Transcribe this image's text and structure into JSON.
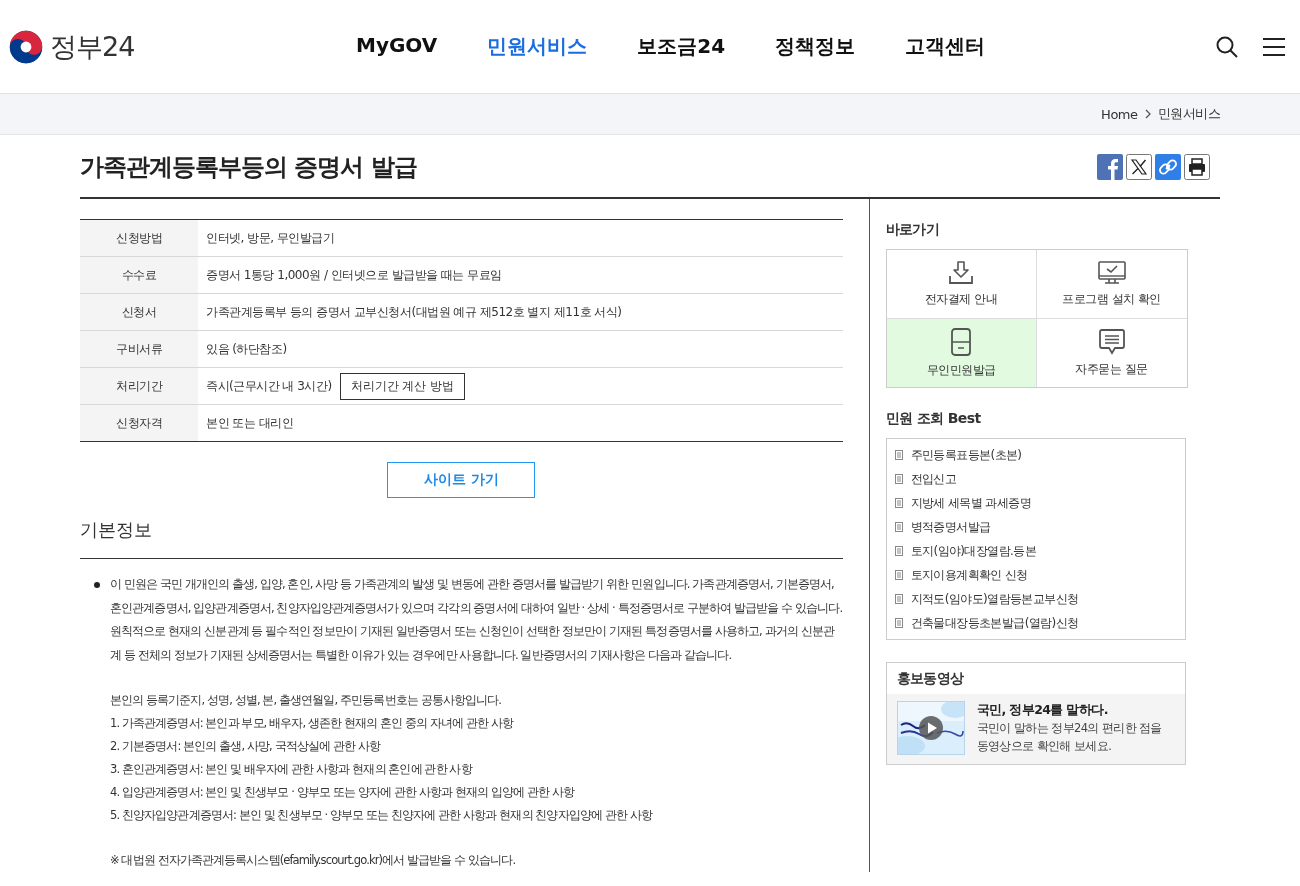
{
  "header": {
    "logo": "정부24",
    "nav": [
      {
        "label": "MyGOV",
        "selected": false
      },
      {
        "label": "민원서비스",
        "selected": true
      },
      {
        "label": "보조금24",
        "selected": false
      },
      {
        "label": "정책정보",
        "selected": false
      },
      {
        "label": "고객센터",
        "selected": false
      }
    ]
  },
  "breadcrumb": [
    "Home",
    "민원서비스"
  ],
  "page_title": "가족관계등록부등의 증명서 발급",
  "summary_table": {
    "rows": [
      {
        "label": "신청방법",
        "value": "인터넷, 방문, 무인발급기"
      },
      {
        "label": "수수료",
        "value": "증명서 1통당 1,000원 / 인터넷으로 발급받을 때는 무료임"
      },
      {
        "label": "신청서",
        "value": "가족관계등록부 등의 증명서 교부신청서(대법원 예규 제512호 별지 제11호 서식)"
      },
      {
        "label": "구비서류",
        "value": "있음 (하단참조)"
      },
      {
        "label": "처리기간",
        "value": "즉시(근무시간 내 3시간)",
        "button": "처리기간 계산 방법"
      },
      {
        "label": "신청자격",
        "value": "본인 또는 대리인"
      }
    ]
  },
  "site_button": "사이트 가기",
  "section_title": "기본정보",
  "description": {
    "intro": "이 민원은 국민 개개인의 출생, 입양, 혼인, 사망 등 가족관계의 발생 및 변동에 관한 증명서를 발급받기 위한 민원입니다. 가족관계증명서, 기본증명서, 혼인관계증명서, 입양관계증명서, 친양자입양관계증명서가 있으며 각각의 증명서에 대하여 일반 · 상세 · 특정증명서로 구분하여 발급받을 수 있습니다. 원칙적으로 현재의 신분관계 등 필수적인 정보만이 기재된 일반증명서 또는 신청인이 선택한 정보만이 기재된 특정증명서를 사용하고, 과거의 신분관계 등 전체의 정보가 기재된 상세증명서는 특별한 이유가 있는 경우에만 사용합니다. 일반증명서의 기재사항은 다음과 같습니다.",
    "common": "본인의 등록기준지, 성명, 성별, 본, 출생연월일, 주민등록번호는 공통사항입니다.",
    "items": [
      "1. 가족관계증명서: 본인과 부모, 배우자, 생존한 현재의 혼인 중의 자녀에 관한 사항",
      "2. 기본증명서: 본인의 출생, 사망, 국적상실에 관한 사항",
      "3. 혼인관계증명서: 본인 및 배우자에 관한 사항과 현재의 혼인에 관한 사항",
      "4. 입양관계증명서: 본인 및 친생부모 · 양부모 또는 양자에 관한 사항과 현재의 입양에 관한 사항",
      "5. 친양자입양관계증명서: 본인 및 친생부모 · 양부모 또는 친양자에 관한 사항과 현재의 친양자입양에 관한 사항"
    ],
    "note": "※ 대법원 전자가족관계등록시스템(efamily.scourt.go.kr)에서 발급받을 수 있습니다."
  },
  "sidebar": {
    "quick_title": "바로가기",
    "quick_links": [
      {
        "label": "전자결제 안내",
        "kind": "download",
        "selected": false
      },
      {
        "label": "프로그램 설치 확인",
        "kind": "monitor",
        "selected": false
      },
      {
        "label": "무인민원발급",
        "kind": "kiosk",
        "selected": true
      },
      {
        "label": "자주묻는 질문",
        "kind": "chat",
        "selected": false
      }
    ],
    "best_title": "민원 조회 Best",
    "best_items": [
      "주민등록표등본(초본)",
      "전입신고",
      "지방세 세목별 과세증명",
      "병적증명서발급",
      "토지(임야)대장열람.등본",
      "토지이용계획확인 신청",
      "지적도(임야도)열람등본교부신청",
      "건축물대장등초본발급(열람)신청"
    ],
    "video": {
      "title": "홍보동영상",
      "headline": "국민, 정부24를 말하다.",
      "lines": [
        "국민이 말하는 정부24의 편리한 점을",
        "동영상으로 확인해 보세요."
      ]
    }
  }
}
